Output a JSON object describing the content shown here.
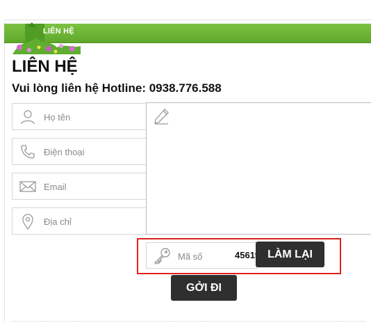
{
  "header": {
    "section_label": "LIÊN HỆ"
  },
  "page": {
    "title": "LIÊN HỆ",
    "hotline_text": "Vui lòng liên hệ Hotline: 0938.776.588"
  },
  "form": {
    "fields": [
      {
        "placeholder": "Họ tên",
        "icon": "user-icon"
      },
      {
        "placeholder": "Điện thoại",
        "icon": "phone-icon"
      },
      {
        "placeholder": "Email",
        "icon": "envelope-icon"
      },
      {
        "placeholder": "Địa chỉ",
        "icon": "map-pin-icon"
      }
    ],
    "message_icon": "pencil-icon",
    "captcha": {
      "placeholder": "Mã số",
      "code": "45619",
      "icon": "key-icon"
    },
    "reset_label": "LÀM LẠI",
    "submit_label": "GỞI ĐI"
  },
  "colors": {
    "header_green": "#6cb534",
    "button_dark": "#2f2f2f",
    "highlight_red": "#e02020"
  }
}
